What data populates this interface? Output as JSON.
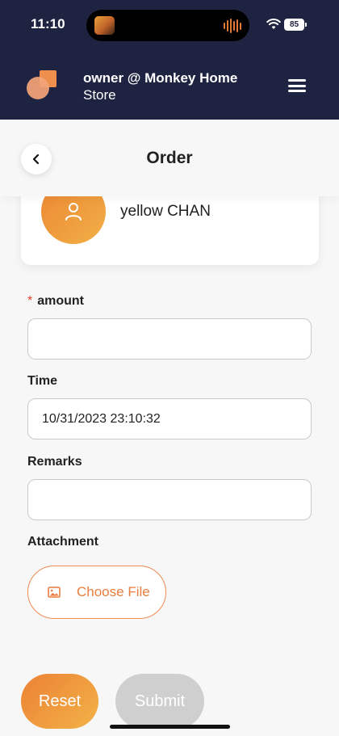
{
  "status_bar": {
    "time": "11:10",
    "battery": "85"
  },
  "header": {
    "user_line": "owner @ Monkey Home",
    "store_line": "Store"
  },
  "page": {
    "title": "Order"
  },
  "customer": {
    "name": "yellow CHAN"
  },
  "form": {
    "amount": {
      "required_mark": "*",
      "label": "amount",
      "value": ""
    },
    "time": {
      "label": "Time",
      "value": "10/31/2023 23:10:32"
    },
    "remarks": {
      "label": "Remarks",
      "value": ""
    },
    "attachment": {
      "label": "Attachment",
      "button_label": "Choose File"
    }
  },
  "actions": {
    "reset_label": "Reset",
    "submit_label": "Submit"
  },
  "colors": {
    "header_bg": "#1d2340",
    "accent": "#ee8a40",
    "disabled": "#cfcfcf"
  }
}
